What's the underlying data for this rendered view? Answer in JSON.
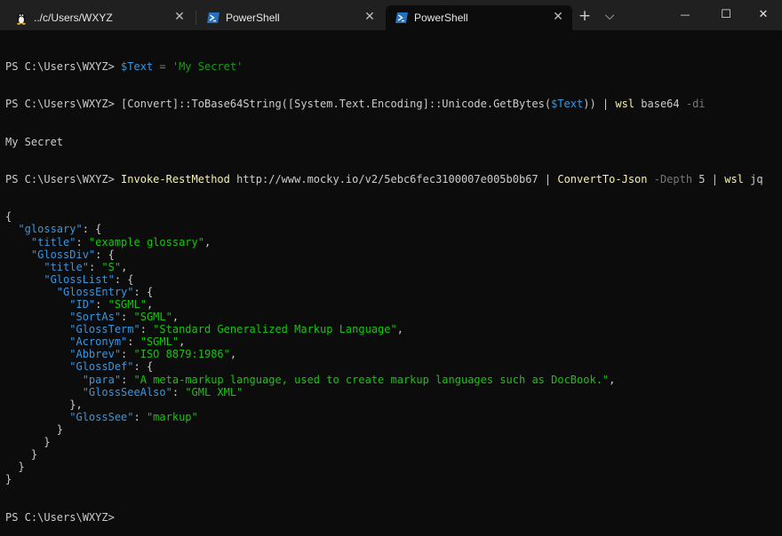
{
  "tabs": [
    {
      "label": "../c/Users/WXYZ",
      "icon": "linux-penguin-icon",
      "active": false
    },
    {
      "label": "PowerShell",
      "icon": "powershell-icon",
      "active": false
    },
    {
      "label": "PowerShell",
      "icon": "powershell-icon",
      "active": true
    }
  ],
  "titlebar": {
    "new_tab_glyph": "+",
    "dropdown_glyph": "⌵",
    "minimize_glyph": "—",
    "maximize_glyph": "☐",
    "close_glyph": "✕",
    "tab_close_glyph": "✕"
  },
  "terminal": {
    "prompt": "PS C:\\Users\\WXYZ> ",
    "line1": {
      "var": "$Text",
      "op": " = ",
      "str": "'My Secret'"
    },
    "line2": {
      "a": "[Convert]",
      "b": "::ToBase64String([System.Text.Encoding]::Unicode.GetBytes(",
      "c": "$Text",
      "d": ")) | ",
      "e": "wsl",
      "f": " base64 ",
      "g": "-di"
    },
    "output1": "My Secret",
    "line3": {
      "cmd": "Invoke-RestMethod",
      "url": " http://www.mocky.io/v2/5ebc6fec3100007e005b0b67 | ",
      "cmd2": "ConvertTo-Json",
      "param": " -Depth ",
      "num": "5",
      "pipe": " | ",
      "wsl": "wsl",
      "jq": " jq"
    },
    "json_lines": [
      {
        "indent": "",
        "key": "",
        "rest": "{"
      },
      {
        "indent": "  ",
        "key": "\"glossary\"",
        "rest": ": {"
      },
      {
        "indent": "    ",
        "key": "\"title\"",
        "rest": ": ",
        "val": "\"example glossary\"",
        "tail": ","
      },
      {
        "indent": "    ",
        "key": "\"GlossDiv\"",
        "rest": ": {"
      },
      {
        "indent": "      ",
        "key": "\"title\"",
        "rest": ": ",
        "val": "\"S\"",
        "tail": ","
      },
      {
        "indent": "      ",
        "key": "\"GlossList\"",
        "rest": ": {"
      },
      {
        "indent": "        ",
        "key": "\"GlossEntry\"",
        "rest": ": {"
      },
      {
        "indent": "          ",
        "key": "\"ID\"",
        "rest": ": ",
        "val": "\"SGML\"",
        "tail": ","
      },
      {
        "indent": "          ",
        "key": "\"SortAs\"",
        "rest": ": ",
        "val": "\"SGML\"",
        "tail": ","
      },
      {
        "indent": "          ",
        "key": "\"GlossTerm\"",
        "rest": ": ",
        "val": "\"Standard Generalized Markup Language\"",
        "tail": ","
      },
      {
        "indent": "          ",
        "key": "\"Acronym\"",
        "rest": ": ",
        "val": "\"SGML\"",
        "tail": ","
      },
      {
        "indent": "          ",
        "key": "\"Abbrev\"",
        "rest": ": ",
        "val": "\"ISO 8879:1986\"",
        "tail": ","
      },
      {
        "indent": "          ",
        "key": "\"GlossDef\"",
        "rest": ": {"
      },
      {
        "indent": "            ",
        "key": "\"para\"",
        "rest": ": ",
        "val": "\"A meta-markup language, used to create markup languages such as DocBook.\"",
        "tail": ","
      },
      {
        "indent": "            ",
        "key": "\"GlossSeeAlso\"",
        "rest": ": ",
        "val": "\"GML XML\"",
        "tail": ""
      },
      {
        "indent": "          ",
        "key": "",
        "rest": "},"
      },
      {
        "indent": "          ",
        "key": "\"GlossSee\"",
        "rest": ": ",
        "val": "\"markup\"",
        "tail": ""
      },
      {
        "indent": "        ",
        "key": "",
        "rest": "}"
      },
      {
        "indent": "      ",
        "key": "",
        "rest": "}"
      },
      {
        "indent": "    ",
        "key": "",
        "rest": "}"
      },
      {
        "indent": "  ",
        "key": "",
        "rest": "}"
      },
      {
        "indent": "",
        "key": "",
        "rest": "}"
      }
    ],
    "final_prompt": "PS C:\\Users\\WXYZ>"
  },
  "colors": {
    "background": "#0c0c0c",
    "titlebar": "#202020",
    "command_yellow": "#f9f1a5",
    "variable_blue": "#3a96dd",
    "string_green": "#16c60c",
    "parameter_gray": "#767676"
  }
}
